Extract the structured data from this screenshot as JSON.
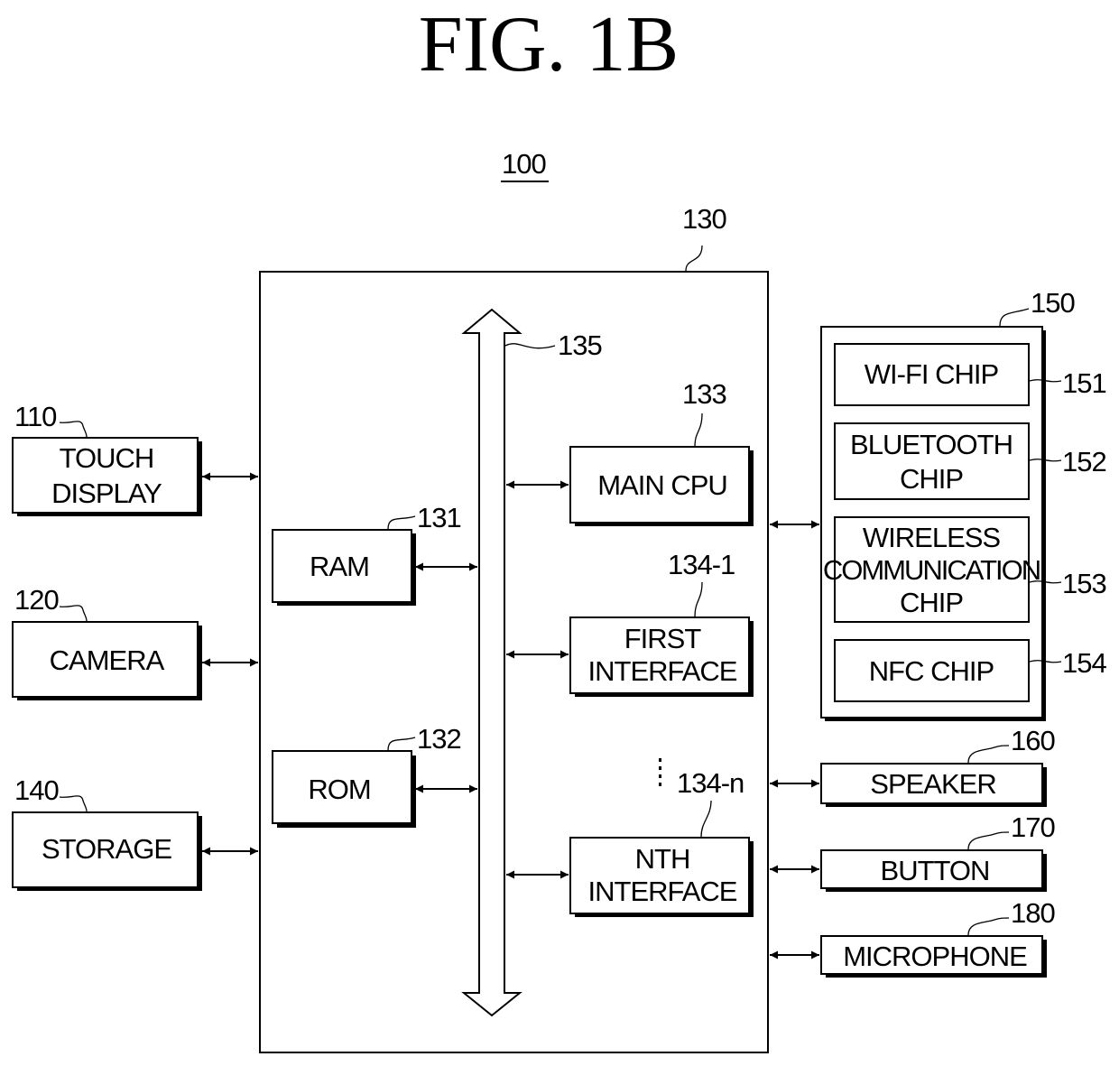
{
  "figure": {
    "title": "FIG.  1B",
    "device_ref": "100"
  },
  "controller": {
    "ref": "130",
    "bus_ref": "135",
    "ram": {
      "ref": "131",
      "label": [
        "RAM"
      ]
    },
    "rom": {
      "ref": "132",
      "label": [
        "ROM"
      ]
    },
    "main_cpu": {
      "ref": "133",
      "label": [
        "MAIN CPU"
      ]
    },
    "first_interface": {
      "ref": "134-1",
      "label": [
        "FIRST",
        "INTERFACE"
      ]
    },
    "nth_interface": {
      "ref": "134-n",
      "label": [
        "NTH",
        "INTERFACE"
      ]
    }
  },
  "left_components": [
    {
      "ref": "110",
      "label": [
        "TOUCH",
        "DISPLAY"
      ]
    },
    {
      "ref": "120",
      "label": [
        "CAMERA"
      ]
    },
    {
      "ref": "140",
      "label": [
        "STORAGE"
      ]
    }
  ],
  "communicator": {
    "ref": "150",
    "chips": [
      {
        "ref": "151",
        "label": [
          "WI-FI CHIP"
        ]
      },
      {
        "ref": "152",
        "label": [
          "BLUETOOTH",
          "CHIP"
        ]
      },
      {
        "ref": "153",
        "label": [
          "WIRELESS",
          "COMMUNICATION",
          "CHIP"
        ]
      },
      {
        "ref": "154",
        "label": [
          "NFC CHIP"
        ]
      }
    ]
  },
  "right_components": [
    {
      "ref": "160",
      "label": [
        "SPEAKER"
      ]
    },
    {
      "ref": "170",
      "label": [
        "BUTTON"
      ]
    },
    {
      "ref": "180",
      "label": [
        "MICROPHONE"
      ]
    }
  ]
}
